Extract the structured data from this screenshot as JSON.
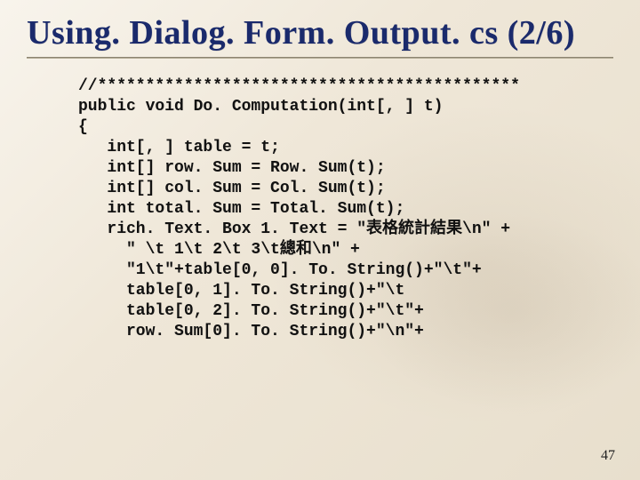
{
  "title": "Using. Dialog. Form. Output. cs (2/6)",
  "code": "//********************************************\npublic void Do. Computation(int[, ] t)\n{\n   int[, ] table = t;\n   int[] row. Sum = Row. Sum(t);\n   int[] col. Sum = Col. Sum(t);\n   int total. Sum = Total. Sum(t);\n   rich. Text. Box 1. Text = \"表格統計結果\\n\" +\n     \" \\t 1\\t 2\\t 3\\t總和\\n\" +\n     \"1\\t\"+table[0, 0]. To. String()+\"\\t\"+\n     table[0, 1]. To. String()+\"\\t\n     table[0, 2]. To. String()+\"\\t\"+\n     row. Sum[0]. To. String()+\"\\n\"+",
  "page_number": "47"
}
